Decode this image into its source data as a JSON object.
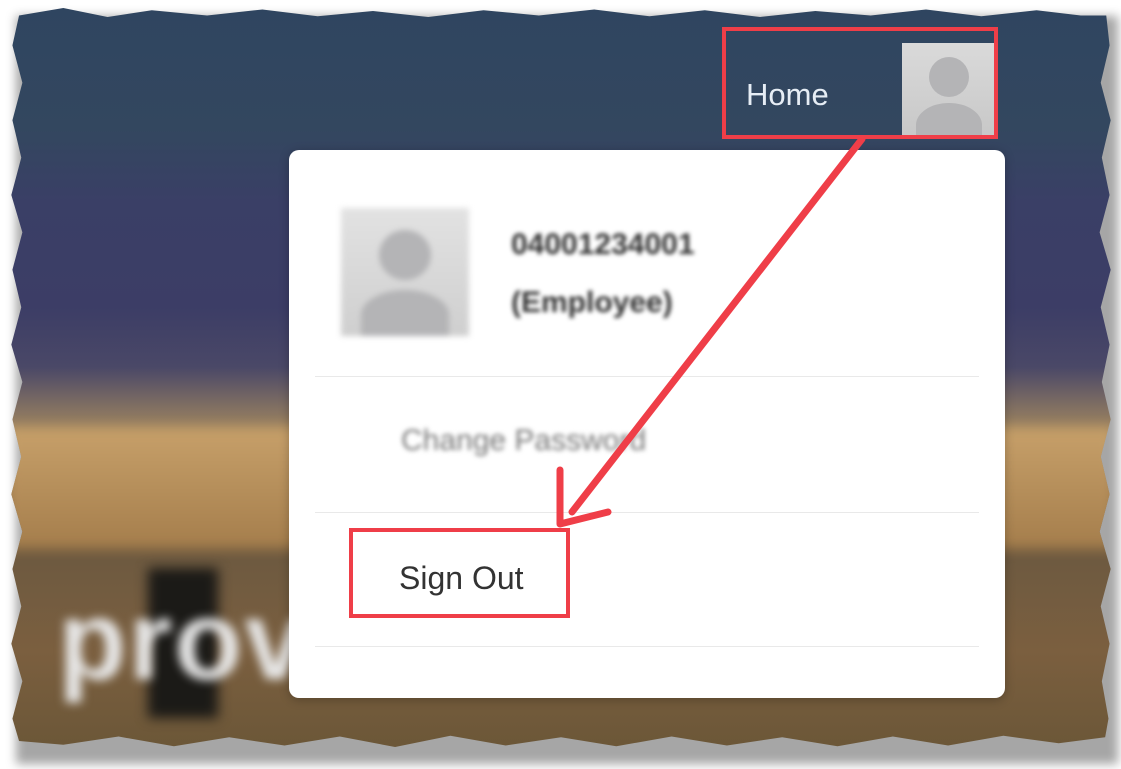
{
  "nav": {
    "home_label": "Home",
    "avatar_icon": "user-avatar-icon"
  },
  "background": {
    "text": "prov"
  },
  "user_menu": {
    "user_id": "04001234001",
    "user_role": "(Employee)",
    "avatar_icon": "user-avatar-icon",
    "items": [
      {
        "label": "Change Password"
      },
      {
        "label": "Sign Out"
      }
    ]
  },
  "colors": {
    "annotation": "#ef3e48",
    "nav_bg": "#2f4560",
    "menu_bg": "#ffffff"
  }
}
